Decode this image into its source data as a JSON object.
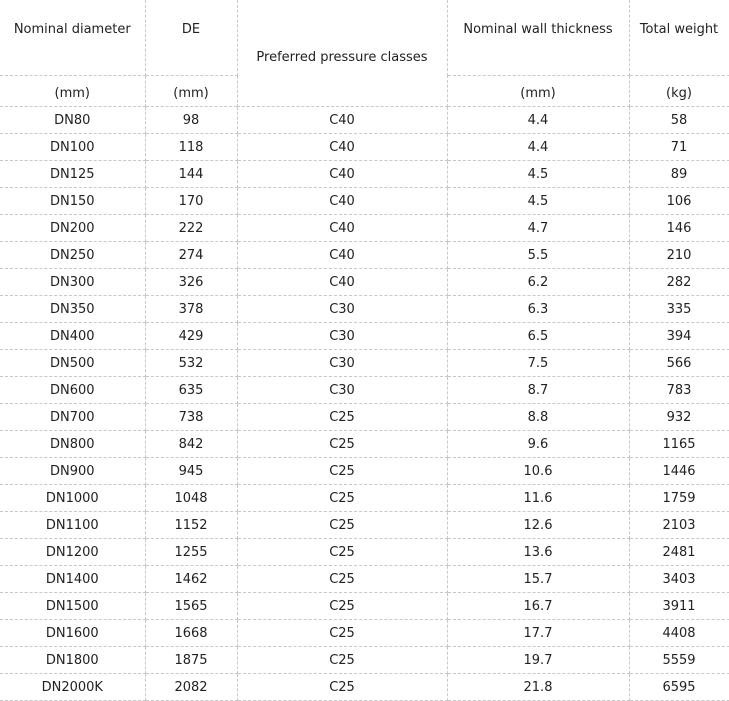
{
  "headers": {
    "nominal_diameter": "Nominal diameter",
    "de": "DE",
    "pressure_classes": "Preferred pressure classes",
    "wall_thickness": "Nominal wall thickness",
    "total_weight": "Total weight"
  },
  "units": {
    "nominal_diameter": "(mm)",
    "de": "(mm)",
    "wall_thickness": "(mm)",
    "total_weight": "(kg)"
  },
  "rows": [
    [
      "DN80",
      "98",
      "C40",
      "4.4",
      "58"
    ],
    [
      "DN100",
      "118",
      "C40",
      "4.4",
      "71"
    ],
    [
      "DN125",
      "144",
      "C40",
      "4.5",
      "89"
    ],
    [
      "DN150",
      "170",
      "C40",
      "4.5",
      "106"
    ],
    [
      "DN200",
      "222",
      "C40",
      "4.7",
      "146"
    ],
    [
      "DN250",
      "274",
      "C40",
      "5.5",
      "210"
    ],
    [
      "DN300",
      "326",
      "C40",
      "6.2",
      "282"
    ],
    [
      "DN350",
      "378",
      "C30",
      "6.3",
      "335"
    ],
    [
      "DN400",
      "429",
      "C30",
      "6.5",
      "394"
    ],
    [
      "DN500",
      "532",
      "C30",
      "7.5",
      "566"
    ],
    [
      "DN600",
      "635",
      "C30",
      "8.7",
      "783"
    ],
    [
      "DN700",
      "738",
      "C25",
      "8.8",
      "932"
    ],
    [
      "DN800",
      "842",
      "C25",
      "9.6",
      "1165"
    ],
    [
      "DN900",
      "945",
      "C25",
      "10.6",
      "1446"
    ],
    [
      "DN1000",
      "1048",
      "C25",
      "11.6",
      "1759"
    ],
    [
      "DN1100",
      "1152",
      "C25",
      "12.6",
      "2103"
    ],
    [
      "DN1200",
      "1255",
      "C25",
      "13.6",
      "2481"
    ],
    [
      "DN1400",
      "1462",
      "C25",
      "15.7",
      "3403"
    ],
    [
      "DN1500",
      "1565",
      "C25",
      "16.7",
      "3911"
    ],
    [
      "DN1600",
      "1668",
      "C25",
      "17.7",
      "4408"
    ],
    [
      "DN1800",
      "1875",
      "C25",
      "19.7",
      "5559"
    ],
    [
      "DN2000K",
      "2082",
      "C25",
      "21.8",
      "6595"
    ]
  ]
}
